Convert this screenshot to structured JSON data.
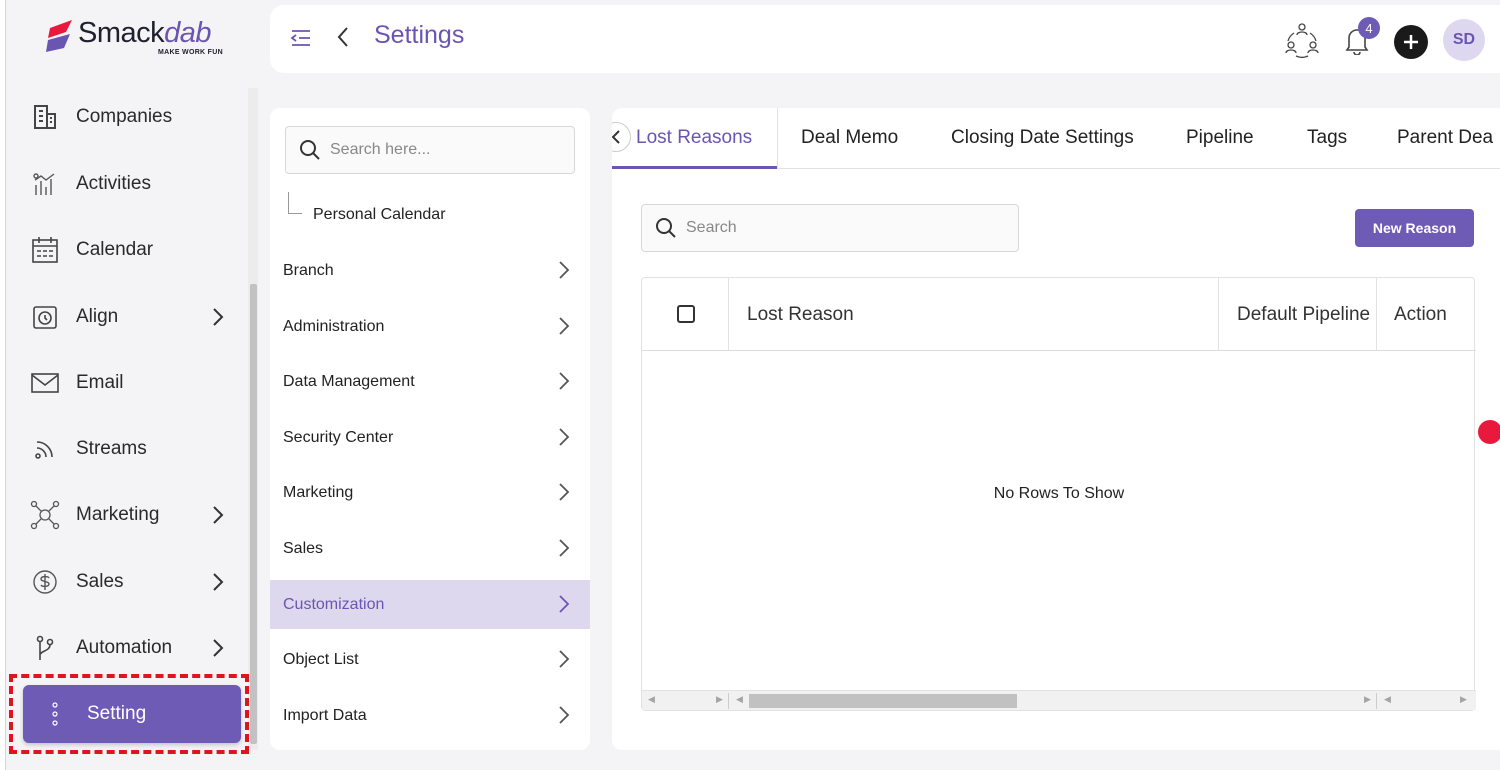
{
  "app": {
    "brand_main": "Smack",
    "brand_accent": "dab",
    "brand_tagline": "MAKE WORK FUN",
    "accent_color": "#6e5bb6",
    "highlight_color": "#e0141e"
  },
  "sidebar": {
    "items": [
      {
        "label": "Companies",
        "icon": "building-icon",
        "has_children": false
      },
      {
        "label": "Activities",
        "icon": "activity-chart-icon",
        "has_children": false
      },
      {
        "label": "Calendar",
        "icon": "calendar-icon",
        "has_children": false
      },
      {
        "label": "Align",
        "icon": "clock-board-icon",
        "has_children": true
      },
      {
        "label": "Email",
        "icon": "mail-icon",
        "has_children": false
      },
      {
        "label": "Streams",
        "icon": "rss-icon",
        "has_children": false
      },
      {
        "label": "Marketing",
        "icon": "network-icon",
        "has_children": true
      },
      {
        "label": "Sales",
        "icon": "dollar-icon",
        "has_children": true
      },
      {
        "label": "Automation",
        "icon": "branch-icon",
        "has_children": true
      }
    ],
    "active_item": {
      "label": "Setting",
      "icon": "kebab-icon"
    }
  },
  "header": {
    "title": "Settings",
    "notification_count": "4",
    "avatar_initials": "SD"
  },
  "settings_menu": {
    "search_placeholder": "Search here...",
    "sub_item": "Personal Calendar",
    "items": [
      {
        "label": "Branch",
        "active": false
      },
      {
        "label": "Administration",
        "active": false
      },
      {
        "label": "Data Management",
        "active": false
      },
      {
        "label": "Security Center",
        "active": false
      },
      {
        "label": "Marketing",
        "active": false
      },
      {
        "label": "Sales",
        "active": false
      },
      {
        "label": "Customization",
        "active": true
      },
      {
        "label": "Object List",
        "active": false
      },
      {
        "label": "Import Data",
        "active": false
      }
    ]
  },
  "content": {
    "tabs": [
      {
        "label": "Lost Reasons",
        "active": true
      },
      {
        "label": "Deal Memo",
        "active": false
      },
      {
        "label": "Closing Date Settings",
        "active": false
      },
      {
        "label": "Pipeline",
        "active": false
      },
      {
        "label": "Tags",
        "active": false
      },
      {
        "label": "Parent Dea",
        "active": false
      }
    ],
    "search_placeholder": "Search",
    "new_button": "New Reason",
    "grid": {
      "columns": [
        "Lost Reason",
        "Default Pipeline",
        "Action"
      ],
      "empty_text": "No Rows To Show"
    }
  }
}
